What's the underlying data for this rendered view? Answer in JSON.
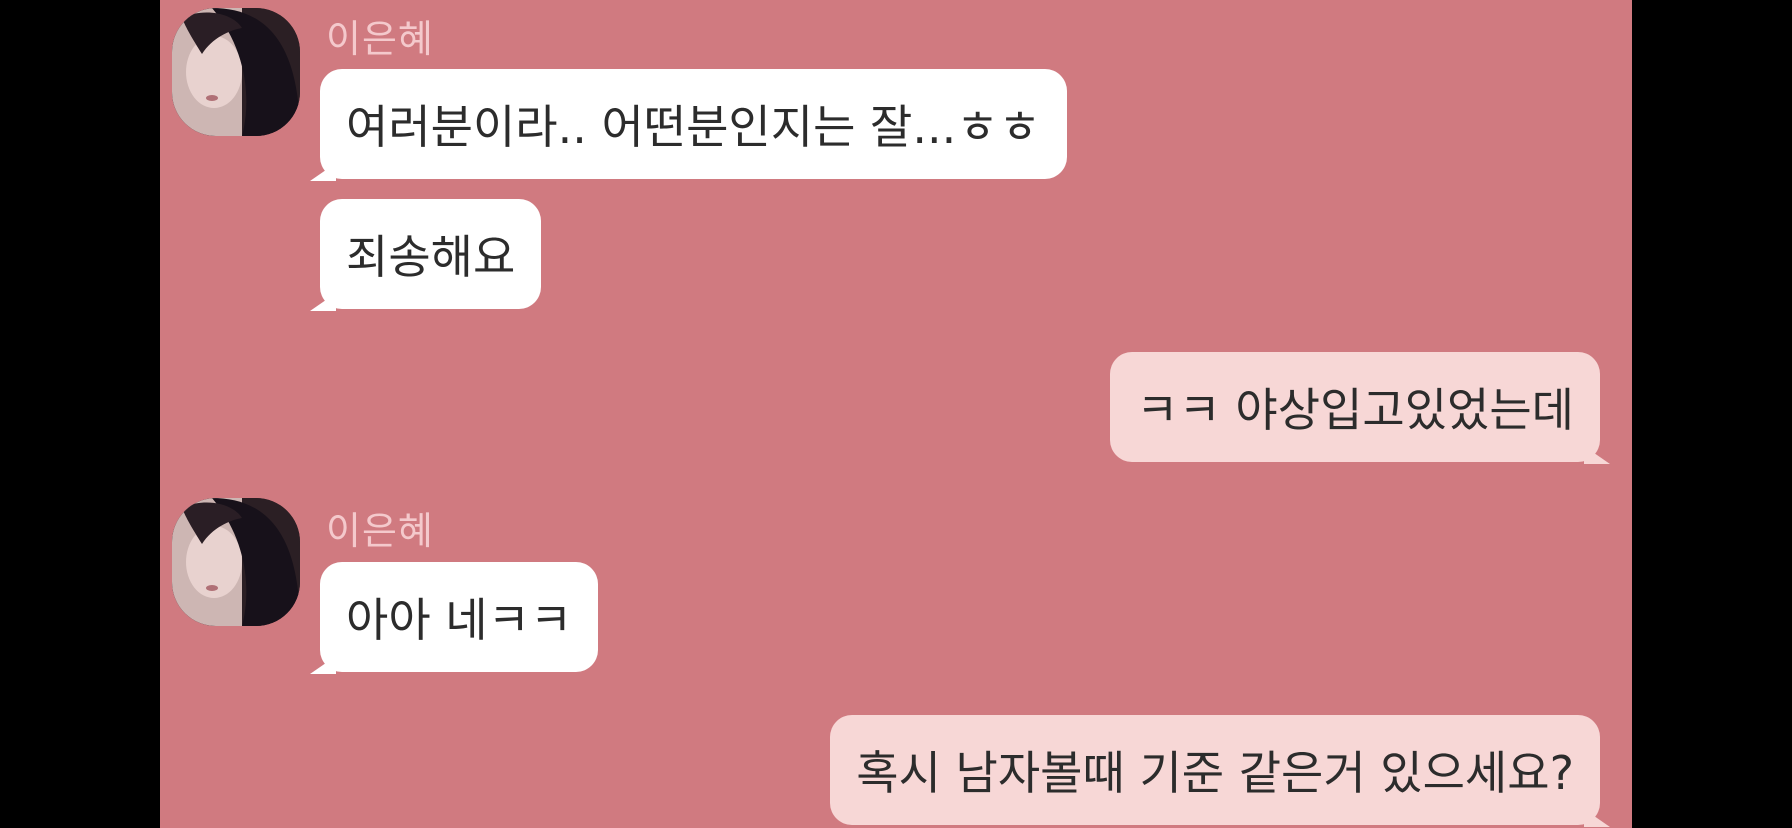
{
  "colors": {
    "background": "#d07a80",
    "letterbox": "#000000",
    "incoming_bubble": "#ffffff",
    "outgoing_bubble": "#f7d7d6",
    "sender_name": "#f4c9cc"
  },
  "messages": [
    {
      "direction": "in",
      "sender": "이은혜",
      "text": "여러분이라.. 어떤분인지는 잘...ㅎㅎ"
    },
    {
      "direction": "in",
      "text": "죄송해요"
    },
    {
      "direction": "out",
      "text": "ㅋㅋ 야상입고있었는데"
    },
    {
      "direction": "in",
      "sender": "이은혜",
      "text": "아아 네ㅋㅋ"
    },
    {
      "direction": "out",
      "text": "혹시 남자볼때 기준 같은거 있으세요?"
    }
  ]
}
